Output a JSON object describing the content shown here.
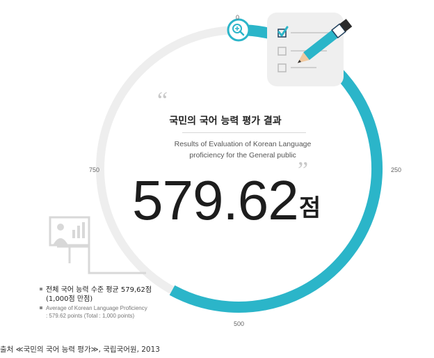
{
  "chart_data": {
    "type": "gauge",
    "value": 579.62,
    "max": 1000,
    "ticks": [
      "0",
      "250",
      "500",
      "750"
    ],
    "title_ko": "국민의 국어 능력 평가 결과",
    "title_en_line1": "Results of Evaluation of Korean Language",
    "title_en_line2": "proficiency for the General public",
    "value_label": "579.62",
    "unit": "점",
    "legend_ko_line1": "전체 국어 능력 수준 평균 579,62점",
    "legend_ko_line2": "(1,000점 만점)",
    "legend_en_line1": "Average of Korean Language Proficiency",
    "legend_en_line2": ": 579.62 points (Total : 1,000 points)"
  },
  "colors": {
    "accent": "#2bb5c9",
    "track": "#eeeeee",
    "icon_gray": "#d8d8d8"
  },
  "icons": [
    "magnifier-plus-icon",
    "checklist-pencil-icon",
    "presentation-board-icon"
  ],
  "source_text": "출처 ≪국민의 국어 능력 평가≫, 국립국어원, 2013"
}
